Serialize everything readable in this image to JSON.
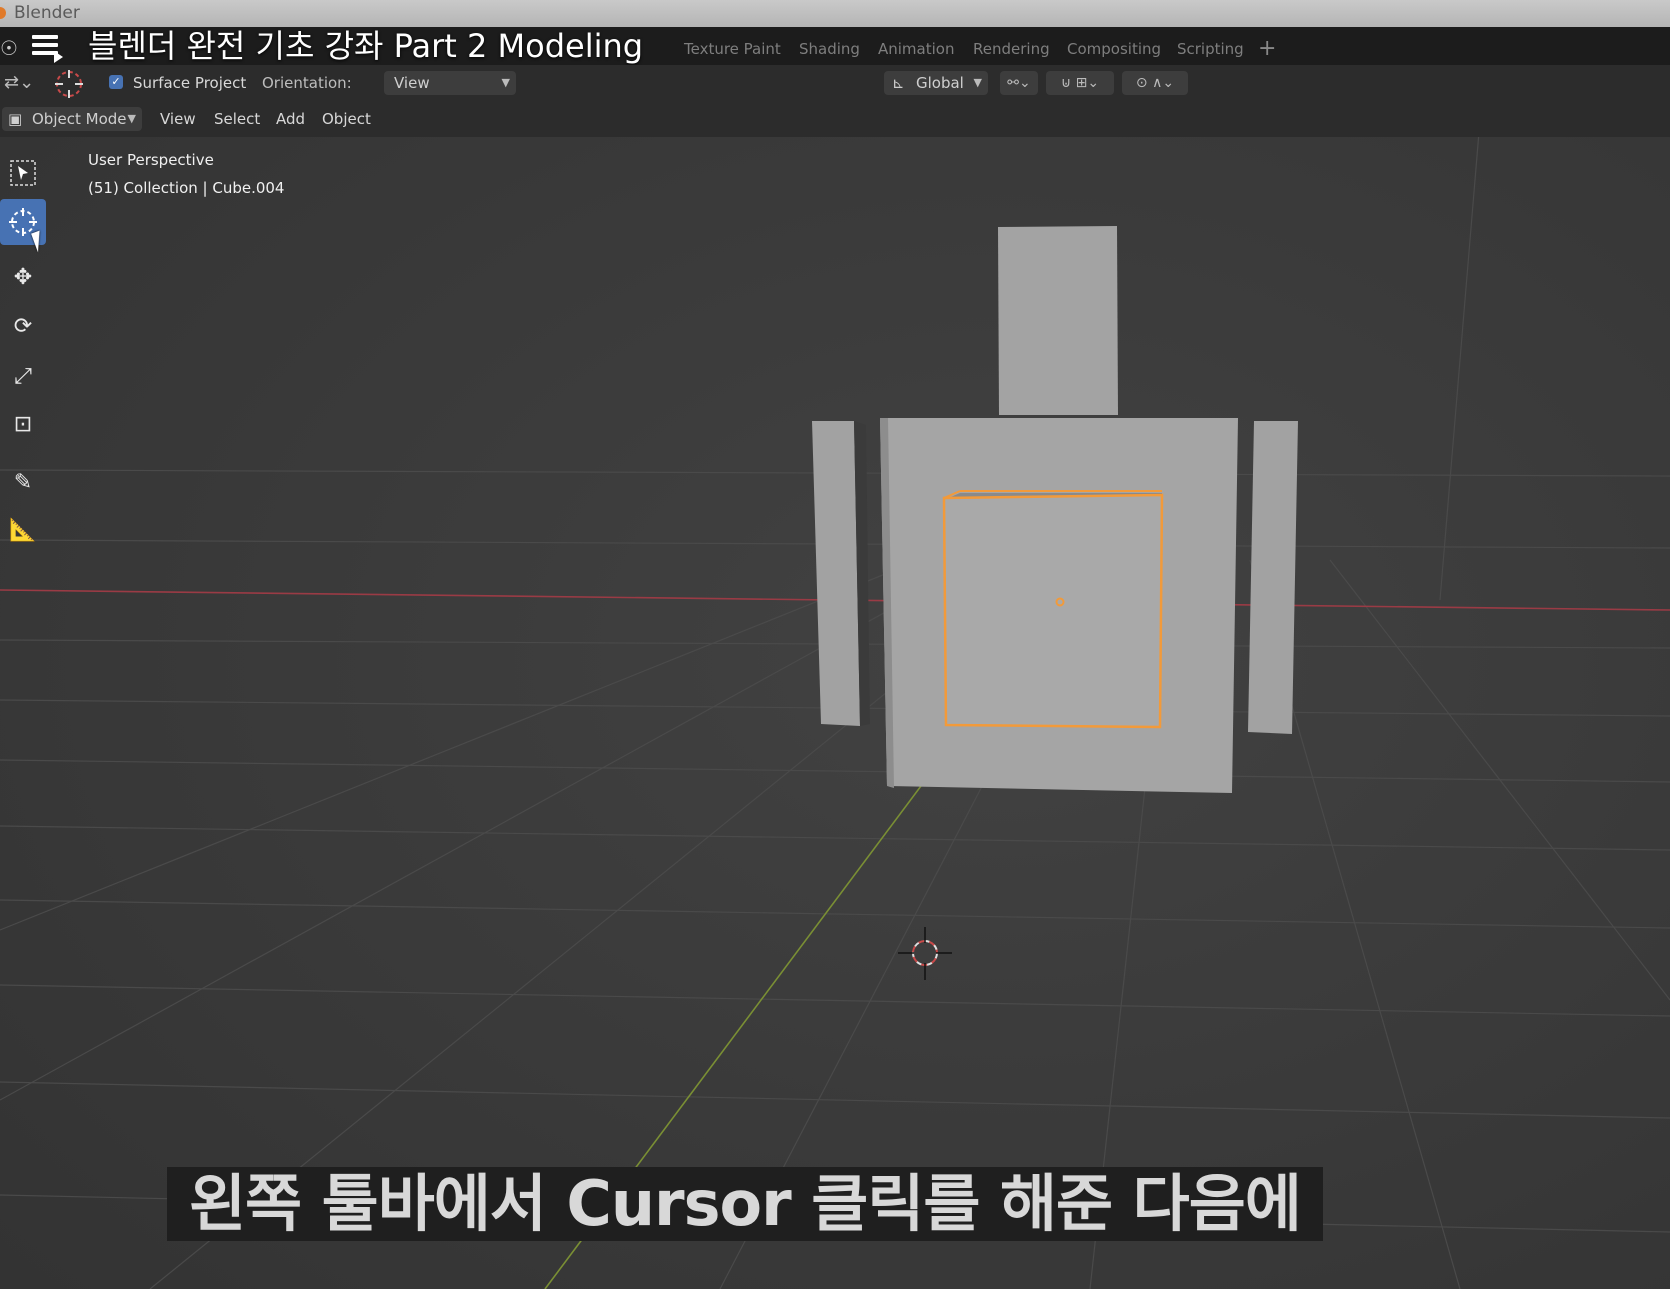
{
  "window": {
    "title": "Blender"
  },
  "video": {
    "title": "블렌더 완전 기초 강좌 Part 2 Modeling"
  },
  "workspace_tabs": [
    {
      "label": "Texture Paint"
    },
    {
      "label": "Shading"
    },
    {
      "label": "Animation"
    },
    {
      "label": "Rendering"
    },
    {
      "label": "Compositing"
    },
    {
      "label": "Scripting"
    }
  ],
  "tool_settings": {
    "surface_project_label": "Surface Project",
    "orientation_label": "Orientation:",
    "orientation_value": "View",
    "transform_orientation": "Global"
  },
  "header": {
    "mode": "Object Mode",
    "menus": [
      {
        "label": "View"
      },
      {
        "label": "Select"
      },
      {
        "label": "Add"
      },
      {
        "label": "Object"
      }
    ]
  },
  "viewport": {
    "perspective": "User Perspective",
    "collection_info": "(51) Collection | Cube.004",
    "colors": {
      "background": "#3a3a3a",
      "selection": "#f29a3a",
      "x_axis": "#9a3b45",
      "y_axis": "#7a8f34"
    }
  },
  "tools": [
    {
      "icon": "select-box-icon"
    },
    {
      "icon": "cursor-icon",
      "active": true
    },
    {
      "icon": "move-icon"
    },
    {
      "icon": "rotate-icon"
    },
    {
      "icon": "scale-icon"
    },
    {
      "icon": "transform-icon"
    },
    {
      "icon": "annotate-icon"
    },
    {
      "icon": "measure-icon"
    }
  ],
  "subtitle": {
    "text": "왼쪽 툴바에서 Cursor 클릭를 해준 다음에"
  }
}
